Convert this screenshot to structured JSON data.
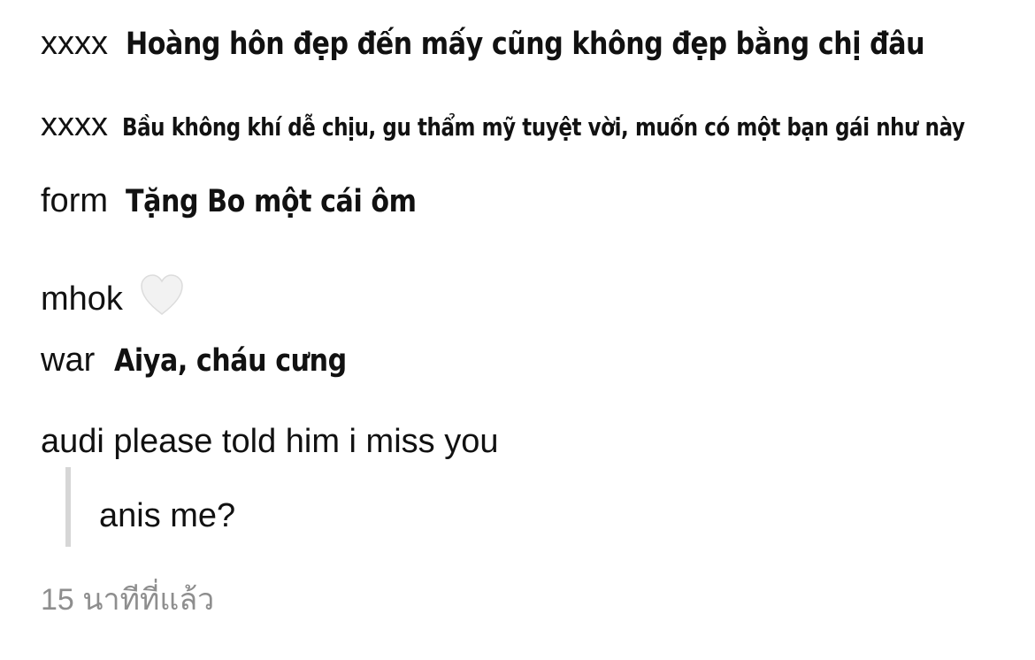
{
  "lines": [
    {
      "name": "xxxx",
      "overlay": "Hoàng hôn đẹp đến mấy cũng không đẹp bằng chị đâu"
    },
    {
      "name": "xxxx",
      "overlay": "Bầu không khí dễ chịu, gu thẩm mỹ tuyệt vời, muốn có một bạn gái như này"
    },
    {
      "name": "form",
      "overlay": "Tặng Bo một cái ôm"
    },
    {
      "name": "mhok",
      "icon": "white-heart-icon"
    },
    {
      "name": "war",
      "overlay": "Aiya, cháu cưng"
    }
  ],
  "comment": "audi please told him i miss you",
  "quote": "anis me?",
  "timestamp": "15 นาทีที่แล้ว",
  "colors": {
    "text": "#111111",
    "timestamp": "#8e8e8e",
    "quote_bar": "#d6d6d6",
    "heart": "#f2f2f2"
  }
}
